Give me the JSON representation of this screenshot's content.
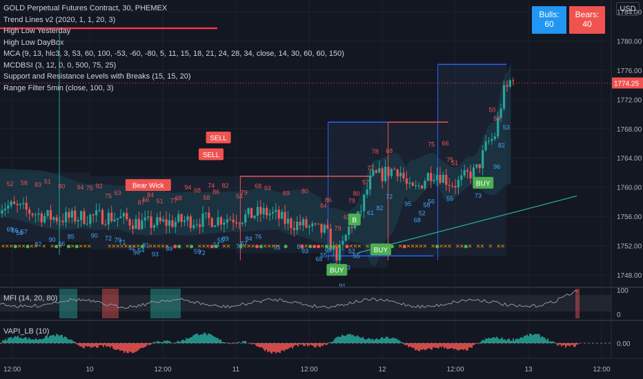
{
  "header": {
    "symbol": "GOLD Perpetual Futures Contract, 30, PHEMEX",
    "indicators": [
      "Trend Lines v2 (2020, 1, 1, 20, 3)",
      "High Low Yesterday",
      "High Low DayBox",
      "MCA  (9, 13, hlc3, 3, 53, 60, 100, -53, -60, -80, 5, 11, 15, 18, 21, 24, 28, 34, close, 14, 30, 60, 60, 150)",
      "MCDBSI (3, 12, 0, 0, 500, 75, 25)",
      " Support and Resistance Levels with Breaks (15, 15, 20)",
      "Range Filter  5min (close, 100, 3)"
    ]
  },
  "badges": {
    "bulls_label": "Bulls:",
    "bulls_value": "60",
    "bears_label": "Bears:",
    "bears_value": "40"
  },
  "currency_button": "USD",
  "colors": {
    "background": "#131722",
    "up": "#26a69a",
    "down": "#ef5350",
    "accent_blue": "#2962ff",
    "buy": "#4caf50",
    "sell": "#ef5350"
  },
  "chart_data": [
    {
      "type": "candlestick",
      "y_ticks": [
        "1748.00",
        "1752.00",
        "1756.00",
        "1760.00",
        "1764.00",
        "1768.00",
        "1772.00",
        "1776.00",
        "1780.00",
        "1784.00"
      ],
      "ylim": [
        1746.4,
        1785.6
      ],
      "x_ticks": [
        "12:00",
        "10",
        "12:00",
        "11",
        "12:00",
        "12",
        "12:00",
        "13",
        "12:00"
      ],
      "last_price": "1774.25",
      "last_price_value": 1774.25,
      "signals": [
        {
          "label": "Bear Wick",
          "x": 0.4,
          "price": 1760.3,
          "kind": "sell"
        },
        {
          "label": "SELL",
          "x": 0.83,
          "price": 1764.5,
          "kind": "sell"
        },
        {
          "label": "SELL",
          "x": 0.88,
          "price": 1766.8,
          "kind": "sell"
        },
        {
          "label": "BUY",
          "x": 1.69,
          "price": 1748.7,
          "kind": "buy"
        },
        {
          "label": "BUY",
          "x": 1.99,
          "price": 1751.5,
          "kind": "buy"
        },
        {
          "label": "BUY",
          "x": 2.69,
          "price": 1760.6,
          "kind": "buy"
        },
        {
          "label": "B",
          "x": 1.81,
          "price": 1755.6,
          "kind": "buy_small"
        }
      ],
      "levels": [
        {
          "price": 1768.9,
          "x_from": 1.63,
          "x_to": 2.04,
          "color": "#2962ff"
        },
        {
          "price": 1750.6,
          "x_from": 1.63,
          "x_to": 2.35,
          "color": "#2962ff"
        },
        {
          "price": 1776.8,
          "x_from": 2.38,
          "x_to": 2.85,
          "color": "#2962ff"
        },
        {
          "price": 1761.5,
          "x_from": 1.03,
          "x_to": 1.93,
          "color": "#ef5350"
        },
        {
          "price": 1768.9,
          "x_from": 2.04,
          "x_to": 2.45,
          "color": "#ef5350"
        }
      ]
    },
    {
      "type": "line",
      "title": "MFI (14, 20, 80)",
      "y_ticks": [
        "0",
        "100"
      ],
      "ylim": [
        0,
        100
      ]
    },
    {
      "type": "area",
      "title": "VAPI_LB (10)",
      "y_ticks": [
        "0.00"
      ]
    }
  ]
}
